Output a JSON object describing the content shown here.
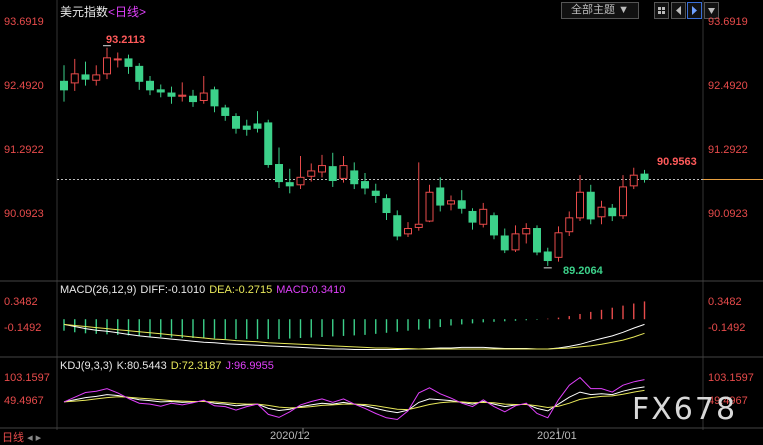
{
  "header": {
    "title": "美元指数",
    "period": "<日线>",
    "theme_select": "全部主题",
    "theme_arrow": "▼"
  },
  "price_axis": {
    "labels": [
      "93.6919",
      "92.4920",
      "91.2922",
      "90.0923"
    ]
  },
  "macd": {
    "label": "MACD(26,12,9)",
    "diff": "DIFF:-0.1010",
    "dea": "DEA:-0.2715",
    "macd": "MACD:0.3410",
    "axis": [
      "0.3482",
      "-0.1492"
    ]
  },
  "kdj": {
    "label": "KDJ(9,3,3)",
    "k": "K:80.5443",
    "d": "D:72.3187",
    "j": "J:96.9955",
    "axis": [
      "103.1597",
      "49.4967"
    ]
  },
  "annotations": {
    "high": "93.2113",
    "low": "89.2064",
    "last": "90.9563"
  },
  "dates": [
    "2020/12",
    "2021/01"
  ],
  "footer": {
    "period": "日线"
  },
  "watermark": "FX678",
  "colors": {
    "up": "#e84b4b",
    "down": "#3cd18a",
    "dif": "#ffffff",
    "dea": "#e8e85a",
    "j": "#e040fb"
  },
  "candles": [
    [
      92.58,
      92.42,
      92.88,
      92.2
    ],
    [
      92.55,
      92.72,
      93.0,
      92.4
    ],
    [
      92.7,
      92.62,
      92.95,
      92.5
    ],
    [
      92.6,
      92.7,
      92.88,
      92.5
    ],
    [
      92.72,
      93.02,
      93.21,
      92.62
    ],
    [
      93.0,
      93.0,
      93.12,
      92.84
    ],
    [
      93.0,
      92.86,
      93.08,
      92.72
    ],
    [
      92.86,
      92.58,
      92.92,
      92.42
    ],
    [
      92.58,
      92.42,
      92.68,
      92.32
    ],
    [
      92.42,
      92.38,
      92.52,
      92.28
    ],
    [
      92.36,
      92.3,
      92.48,
      92.16
    ],
    [
      92.3,
      92.32,
      92.56,
      92.2
    ],
    [
      92.3,
      92.2,
      92.42,
      92.1
    ],
    [
      92.22,
      92.36,
      92.68,
      92.16
    ],
    [
      92.42,
      92.12,
      92.48,
      92.0
    ],
    [
      92.08,
      91.94,
      92.14,
      91.84
    ],
    [
      91.92,
      91.7,
      91.98,
      91.6
    ],
    [
      91.74,
      91.68,
      91.86,
      91.56
    ],
    [
      91.78,
      91.7,
      92.02,
      91.62
    ],
    [
      91.8,
      91.02,
      91.86,
      90.96
    ],
    [
      91.02,
      90.7,
      91.34,
      90.58
    ],
    [
      90.68,
      90.62,
      90.94,
      90.48
    ],
    [
      90.64,
      90.78,
      91.18,
      90.56
    ],
    [
      90.8,
      90.9,
      91.04,
      90.7
    ],
    [
      90.88,
      91.0,
      91.2,
      90.78
    ],
    [
      90.98,
      90.72,
      91.24,
      90.6
    ],
    [
      90.76,
      91.0,
      91.18,
      90.68
    ],
    [
      90.9,
      90.66,
      91.06,
      90.56
    ],
    [
      90.7,
      90.58,
      90.86,
      90.46
    ],
    [
      90.52,
      90.44,
      90.66,
      90.3
    ],
    [
      90.38,
      90.12,
      90.46,
      89.98
    ],
    [
      90.06,
      89.68,
      90.16,
      89.6
    ],
    [
      89.72,
      89.82,
      89.94,
      89.66
    ],
    [
      89.84,
      89.9,
      91.06,
      89.78
    ],
    [
      89.96,
      90.5,
      90.64,
      89.94
    ],
    [
      90.58,
      90.26,
      90.78,
      90.14
    ],
    [
      90.28,
      90.34,
      90.44,
      90.16
    ],
    [
      90.34,
      90.2,
      90.54,
      90.1
    ],
    [
      90.14,
      89.94,
      90.2,
      89.8
    ],
    [
      89.9,
      90.18,
      90.3,
      89.84
    ],
    [
      90.06,
      89.7,
      90.12,
      89.62
    ],
    [
      89.68,
      89.42,
      89.82,
      89.36
    ],
    [
      89.42,
      89.72,
      89.88,
      89.38
    ],
    [
      89.72,
      89.82,
      89.92,
      89.54
    ],
    [
      89.82,
      89.38,
      89.88,
      89.32
    ],
    [
      89.38,
      89.22,
      89.46,
      89.12
    ],
    [
      89.28,
      89.74,
      89.86,
      89.2
    ],
    [
      89.76,
      90.02,
      90.14,
      89.68
    ],
    [
      90.02,
      90.5,
      90.82,
      89.96
    ],
    [
      90.5,
      90.0,
      90.64,
      89.9
    ],
    [
      90.04,
      90.22,
      90.34,
      89.9
    ],
    [
      90.2,
      90.06,
      90.28,
      89.96
    ],
    [
      90.06,
      90.6,
      90.82,
      90.0
    ],
    [
      90.62,
      90.82,
      90.96,
      90.56
    ],
    [
      90.84,
      90.74,
      90.92,
      90.68
    ]
  ],
  "indicators": {
    "macd_bars": [
      -0.22,
      -0.25,
      -0.27,
      -0.28,
      -0.29,
      -0.3,
      -0.31,
      -0.32,
      -0.33,
      -0.34,
      -0.35,
      -0.36,
      -0.36,
      -0.37,
      -0.37,
      -0.38,
      -0.38,
      -0.38,
      -0.38,
      -0.38,
      -0.38,
      -0.37,
      -0.36,
      -0.35,
      -0.34,
      -0.33,
      -0.32,
      -0.31,
      -0.3,
      -0.28,
      -0.26,
      -0.24,
      -0.22,
      -0.2,
      -0.18,
      -0.15,
      -0.12,
      -0.1,
      -0.08,
      -0.06,
      -0.05,
      -0.04,
      -0.03,
      -0.02,
      -0.01,
      0.01,
      0.03,
      0.06,
      0.1,
      0.14,
      0.18,
      0.22,
      0.26,
      0.3,
      0.34
    ],
    "dif": [
      -0.1,
      -0.14,
      -0.18,
      -0.21,
      -0.23,
      -0.26,
      -0.29,
      -0.32,
      -0.34,
      -0.36,
      -0.38,
      -0.4,
      -0.42,
      -0.44,
      -0.45,
      -0.47,
      -0.48,
      -0.49,
      -0.5,
      -0.51,
      -0.52,
      -0.53,
      -0.54,
      -0.55,
      -0.56,
      -0.57,
      -0.57,
      -0.58,
      -0.58,
      -0.58,
      -0.58,
      -0.58,
      -0.57,
      -0.57,
      -0.56,
      -0.55,
      -0.55,
      -0.54,
      -0.54,
      -0.54,
      -0.55,
      -0.56,
      -0.56,
      -0.56,
      -0.57,
      -0.57,
      -0.55,
      -0.52,
      -0.48,
      -0.42,
      -0.37,
      -0.32,
      -0.25,
      -0.17,
      -0.1
    ],
    "dea": [
      -0.1,
      -0.12,
      -0.14,
      -0.16,
      -0.18,
      -0.2,
      -0.22,
      -0.24,
      -0.26,
      -0.28,
      -0.3,
      -0.32,
      -0.34,
      -0.36,
      -0.38,
      -0.39,
      -0.41,
      -0.42,
      -0.43,
      -0.45,
      -0.46,
      -0.47,
      -0.48,
      -0.49,
      -0.5,
      -0.51,
      -0.52,
      -0.53,
      -0.54,
      -0.55,
      -0.55,
      -0.56,
      -0.56,
      -0.57,
      -0.57,
      -0.57,
      -0.57,
      -0.57,
      -0.57,
      -0.57,
      -0.57,
      -0.57,
      -0.57,
      -0.57,
      -0.57,
      -0.57,
      -0.56,
      -0.55,
      -0.53,
      -0.51,
      -0.48,
      -0.44,
      -0.4,
      -0.34,
      -0.27
    ],
    "k": [
      45,
      50,
      55,
      58,
      62,
      60,
      55,
      50,
      48,
      45,
      46,
      44,
      45,
      47,
      42,
      40,
      36,
      38,
      40,
      30,
      25,
      28,
      34,
      38,
      42,
      40,
      44,
      40,
      36,
      30,
      24,
      20,
      26,
      44,
      52,
      50,
      48,
      44,
      40,
      46,
      40,
      34,
      38,
      40,
      30,
      24,
      40,
      56,
      68,
      62,
      64,
      62,
      70,
      76,
      80
    ],
    "d": [
      45,
      47,
      49,
      52,
      55,
      57,
      56,
      54,
      52,
      50,
      48,
      47,
      46,
      46,
      45,
      43,
      41,
      40,
      40,
      37,
      33,
      31,
      32,
      34,
      37,
      38,
      40,
      40,
      39,
      36,
      32,
      28,
      27,
      33,
      39,
      43,
      45,
      45,
      43,
      44,
      43,
      40,
      39,
      39,
      36,
      32,
      35,
      42,
      51,
      55,
      58,
      59,
      63,
      68,
      72
    ],
    "j": [
      45,
      56,
      67,
      70,
      76,
      66,
      53,
      42,
      40,
      35,
      42,
      38,
      43,
      49,
      36,
      34,
      26,
      34,
      40,
      16,
      9,
      22,
      38,
      46,
      52,
      44,
      52,
      40,
      30,
      18,
      8,
      4,
      24,
      66,
      78,
      64,
      54,
      42,
      34,
      50,
      34,
      22,
      36,
      42,
      18,
      8,
      50,
      84,
      102,
      76,
      76,
      68,
      84,
      92,
      97
    ]
  }
}
